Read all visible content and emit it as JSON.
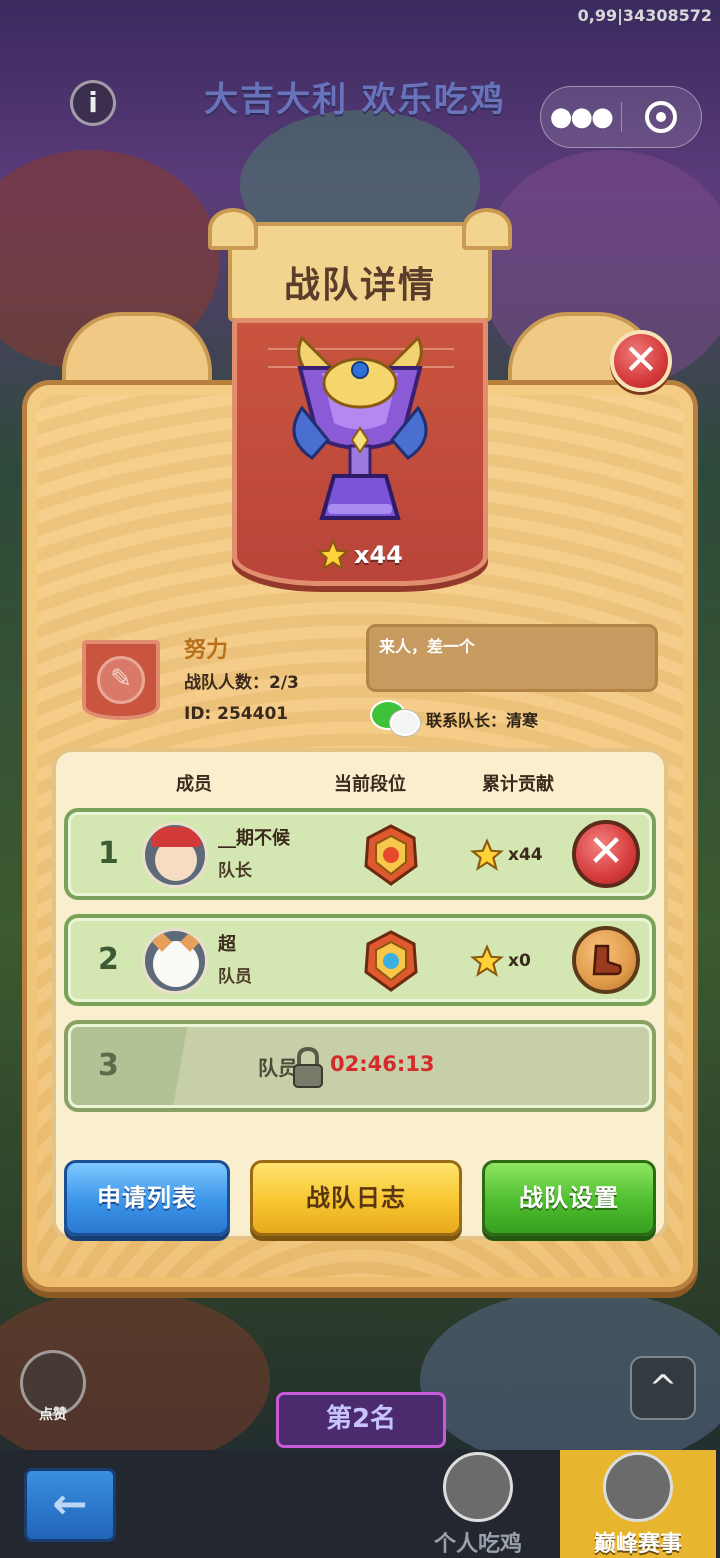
{
  "status": {
    "top_right": "0,99|34308572"
  },
  "background": {
    "banner": "大吉大利 欢乐吃鸡"
  },
  "capsule": {
    "more_icon": "more-icon",
    "close_icon": "target-icon"
  },
  "dialog": {
    "title": "战队详情",
    "close_icon": "close-icon",
    "trophy": {
      "stars": "x44"
    },
    "team": {
      "name": "努力",
      "count": "战队人数：2/3",
      "id": "ID: 254401",
      "motto": "来人，差一个",
      "contact": "联系队长：清寒"
    },
    "columns": {
      "member": "成员",
      "rank": "当前段位",
      "contribution": "累计贡献"
    },
    "members": [
      {
        "index": "1",
        "name": "__期不候",
        "role": "队长",
        "contribution": "x44",
        "action_icon": "close-icon"
      },
      {
        "index": "2",
        "name": "超",
        "role": "队员",
        "contribution": "x0",
        "action_icon": "boot-icon"
      }
    ],
    "locked_slot": {
      "index": "3",
      "label": "队员",
      "timer": "02:46:13"
    },
    "buttons": {
      "apply_list": "申请列表",
      "team_log": "战队日志",
      "team_settings": "战队设置"
    }
  },
  "bottom": {
    "like_label": "点赞",
    "up_icon": "^",
    "rank_badge": "第2名",
    "back_icon": "←",
    "tabs": [
      {
        "label": "个人吃鸡"
      },
      {
        "label": "巅峰赛事"
      }
    ]
  },
  "colors": {
    "panel": "#f3c67c",
    "banner_red": "#c9553f",
    "member_row": "#d4e6b2",
    "timer": "#d42a2a"
  }
}
